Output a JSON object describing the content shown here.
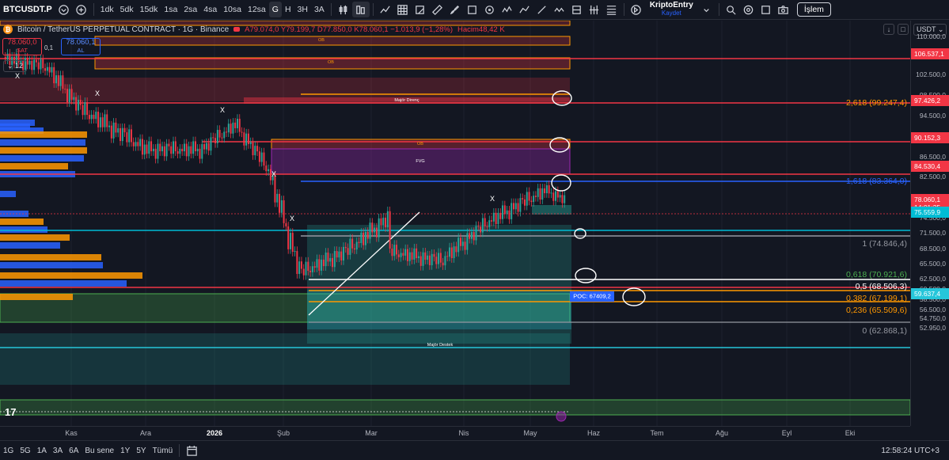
{
  "toolbar": {
    "symbol": "BTCUSDT.P",
    "intervals": [
      "1dk",
      "5dk",
      "15dk",
      "1sa",
      "2sa",
      "4sa",
      "10sa",
      "12sa",
      "G",
      "H",
      "3H",
      "3A"
    ],
    "active_interval": "G",
    "brand_name": "KriptoEntry",
    "brand_sub": "Kaydet",
    "trade_button": "İşlem"
  },
  "legend": {
    "title": "Bitcoin / TetherUS PERPETUAL CONTRACT · 1G · Binance",
    "ohlc": "A79.074,0 Y79.199,7 D77.850,0 K78.060,1 −1.013,9 (−1,28%)",
    "volume": "Hacim48,42 K",
    "sell_price": "78.060,0",
    "sell_label": "SAT",
    "mid_value": "0,1",
    "buy_price": "78.060,1",
    "buy_label": "AL",
    "indicator_count": "12"
  },
  "price_axis": {
    "currency": "USDT",
    "levels": [
      "110.000,0",
      "106.537,1",
      "102.500,0",
      "98.500,0",
      "97.426,2",
      "94.500,0",
      "90.152,3",
      "86.500,0",
      "84.530,4",
      "82.500,0",
      "78.060,1",
      "75.559,9",
      "74.500,0",
      "71.500,0",
      "68.500,0",
      "65.500,0",
      "62.500,0",
      "60.500,0",
      "59.637,4",
      "58.500,0",
      "56.500,0",
      "54.750,0",
      "52.950,0"
    ],
    "tags": [
      {
        "text": "106.537,1",
        "price": 106537.1,
        "color": "#f23645"
      },
      {
        "text": "97.426,2",
        "price": 97426.2,
        "color": "#f23645"
      },
      {
        "text": "90.152,3",
        "price": 90152.3,
        "color": "#f23645"
      },
      {
        "text": "84.530,4",
        "price": 84530.4,
        "color": "#f23645"
      },
      {
        "text": "78.060,1",
        "price": 78060.1,
        "color": "#f23645",
        "sub": "14:01:35"
      },
      {
        "text": "75.559,9",
        "price": 75559.9,
        "color": "#00bcd4"
      },
      {
        "text": "59.637,4",
        "price": 59637.4,
        "color": "#26c6da"
      }
    ]
  },
  "time_axis": {
    "labels": [
      "Kas",
      "Ara",
      "2026",
      "Şub",
      "Mar",
      "Nis",
      "May",
      "Haz",
      "Tem",
      "Ağu",
      "Eyl",
      "Eki"
    ],
    "bold_label": "2026"
  },
  "fib": {
    "labels": [
      {
        "text": "2,618 (99.247,4)",
        "price": 99247.4,
        "color": "#ff9800"
      },
      {
        "text": "1,618 (83.364,0)",
        "price": 83364.0,
        "color": "#2962ff"
      },
      {
        "text": "1 (74.846,4)",
        "price": 74846.4,
        "color": "#9598a1"
      },
      {
        "text": "0,618 (70.921,6)",
        "price": 68900,
        "color": "#4caf50"
      },
      {
        "text": "0,5 (68.506,3)",
        "price": 67400,
        "color": "#ffffff"
      },
      {
        "text": "0,382 (67.199,1)",
        "price": 66000,
        "color": "#ff9800"
      },
      {
        "text": "0,236 (65.509,6)",
        "price": 64300,
        "color": "#ff9800"
      },
      {
        "text": "0 (62.868,1)",
        "price": 61750,
        "color": "#9598a1"
      }
    ]
  },
  "zones": {
    "ob_label": "OB",
    "fvg_label": "FVG",
    "major_resistance": "Majör Direnç",
    "major_support": "Majör Destek",
    "poc": "POC: 67409,2"
  },
  "bottom_bar": {
    "ranges": [
      "1G",
      "5G",
      "1A",
      "3A",
      "6A",
      "Bu sene",
      "1Y",
      "5Y",
      "Tümü"
    ],
    "clock": "12:58:24 UTC+3"
  }
}
